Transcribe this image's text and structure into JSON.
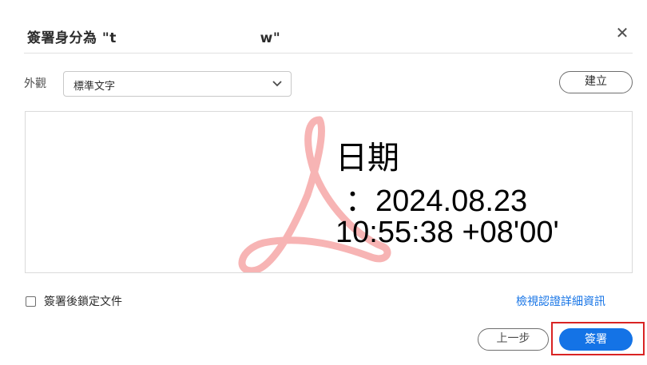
{
  "dialog": {
    "title": "簽署身分為 \"t                            w\"",
    "close_icon": "close-icon"
  },
  "appearance": {
    "label": "外觀",
    "selected": "標準文字",
    "create_button": "建立"
  },
  "preview": {
    "line1": "日期",
    "line2": "：2024.08.23",
    "line3": "10:55:38 +08'00'",
    "watermark_icon": "acrobat-logo-icon",
    "watermark_color": "#f7b4b4"
  },
  "options": {
    "lock_label": "簽署後鎖定文件",
    "lock_checked": false,
    "details_link": "檢視認證詳細資訊"
  },
  "footer": {
    "back_button": "上一步",
    "sign_button": "簽署"
  },
  "colors": {
    "accent": "#1473e6",
    "highlight": "#d92323"
  }
}
